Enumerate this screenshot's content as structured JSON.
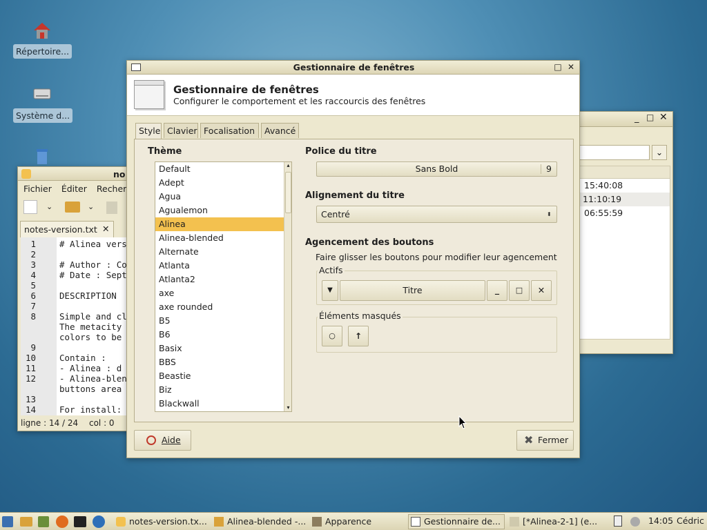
{
  "desktop": {
    "icons": [
      {
        "label": "Répertoire..."
      },
      {
        "label": "Système d..."
      },
      {
        "label": ""
      }
    ]
  },
  "editor": {
    "title": "no",
    "menu": [
      "Fichier",
      "Éditer",
      "Recherc"
    ],
    "tab_label": "notes-version.txt",
    "lines": [
      {
        "n": "1",
        "t": "# Alinea vers"
      },
      {
        "n": "2",
        "t": ""
      },
      {
        "n": "3",
        "t": "# Author : Co"
      },
      {
        "n": "4",
        "t": "# Date : Sept"
      },
      {
        "n": "5",
        "t": ""
      },
      {
        "n": "6",
        "t": "DESCRIPTION"
      },
      {
        "n": "7",
        "t": ""
      },
      {
        "n": "8",
        "t": "Simple and cl"
      },
      {
        "n": "",
        "t": "The metacity"
      },
      {
        "n": "",
        "t": "colors to be"
      },
      {
        "n": "9",
        "t": ""
      },
      {
        "n": "10",
        "t": "Contain :"
      },
      {
        "n": "11",
        "t": "- Alinea : d"
      },
      {
        "n": "12",
        "t": "- Alinea-blen"
      },
      {
        "n": "",
        "t": "buttons area"
      },
      {
        "n": "13",
        "t": ""
      },
      {
        "n": "14",
        "t": "For install:"
      }
    ],
    "status_line": "ligne : 14 / 24",
    "status_col": "col : 0"
  },
  "back_right": {
    "times": [
      "15:40:08",
      "11:10:19",
      "06:55:59"
    ]
  },
  "dialog": {
    "title": "Gestionnaire de fenêtres",
    "header_title": "Gestionnaire de fenêtres",
    "header_subtitle": "Configurer le comportement et les raccourcis des fenêtres",
    "tabs": [
      "Style",
      "Clavier",
      "Focalisation",
      "Avancé"
    ],
    "theme_label": "Thème",
    "themes": [
      "Default",
      "Adept",
      "Agua",
      "Agualemon",
      "Alinea",
      "Alinea-blended",
      "Alternate",
      "Atlanta",
      "Atlanta2",
      "axe",
      "axe rounded",
      "B5",
      "B6",
      "Basix",
      "BBS",
      "Beastie",
      "Biz",
      "Blackwall"
    ],
    "selected_theme": "Alinea",
    "font_label": "Police du titre",
    "font_name": "Sans Bold",
    "font_size": "9",
    "align_label": "Alignement du titre",
    "align_value": "Centré",
    "layout_label": "Agencement des boutons",
    "layout_hint": "Faire glisser les boutons pour modifier leur agencement",
    "active_label": "Actifs",
    "title_btn": "Titre",
    "hidden_label": "Éléments masqués",
    "help_btn": "Aide",
    "close_btn": "Fermer"
  },
  "taskbar": {
    "tasks": [
      "notes-version.tx...",
      "Alinea-blended -...",
      "Apparence",
      "Gestionnaire de...",
      "[*Alinea-2-1] (e..."
    ],
    "clock": "14:05",
    "user": "Cédric"
  }
}
